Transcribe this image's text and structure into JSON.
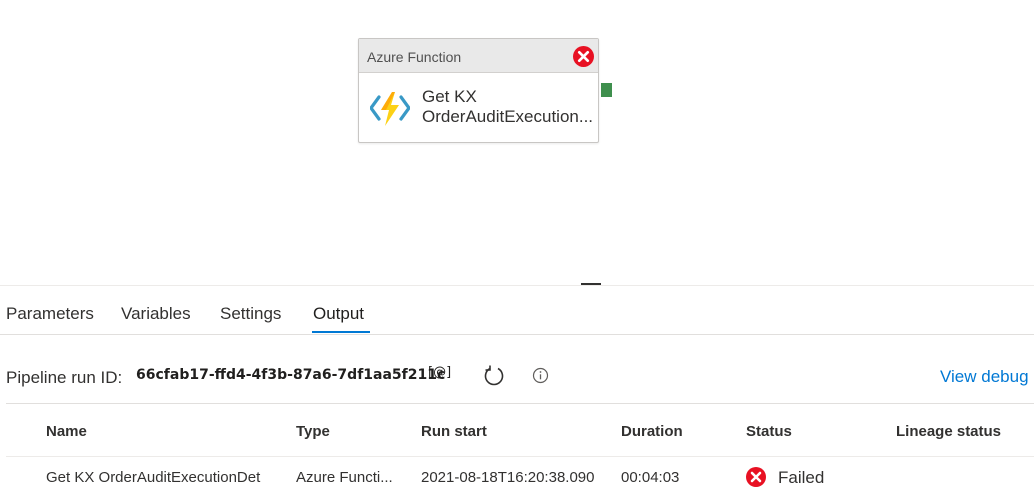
{
  "activity": {
    "type_label": "Azure Function",
    "name_line1": "Get KX",
    "name_line2": "OrderAuditExecution...",
    "status_icon": "error-icon",
    "icon": "azure-function-icon"
  },
  "tabs": [
    {
      "label": "Parameters"
    },
    {
      "label": "Variables"
    },
    {
      "label": "Settings"
    },
    {
      "label": "Output",
      "active": true
    }
  ],
  "run": {
    "label": "Pipeline run ID:",
    "id": "66cfab17-ffd4-4f3b-87a6-7df1aa5f211c",
    "copy_label": "[@]",
    "debug_link": "View debug r"
  },
  "table": {
    "columns": [
      "Name",
      "Type",
      "Run start",
      "Duration",
      "Status",
      "Lineage status"
    ],
    "rows": [
      {
        "name": "Get KX OrderAuditExecutionDet",
        "type": "Azure Functi...",
        "run_start": "2021-08-18T16:20:38.090",
        "duration": "00:04:03",
        "status": "Failed",
        "lineage_status": ""
      }
    ]
  },
  "colors": {
    "accent": "#0078d4",
    "error": "#e81123",
    "success_port": "#3e8f4d"
  }
}
